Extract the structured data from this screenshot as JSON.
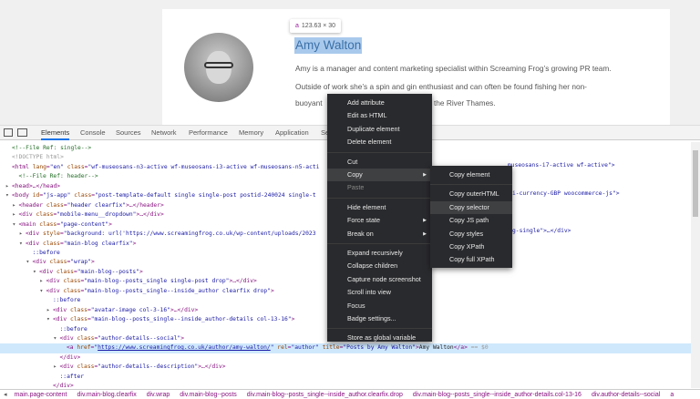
{
  "page": {
    "tooltip_tag": "a",
    "tooltip_size": "123.63 × 30",
    "author_name": "Amy Walton",
    "bio_line1": "Amy is a manager and content marketing specialist within Screaming Frog’s growing PR team.",
    "bio_line2": "Outside of work she’s a spin and gin enthusiast and can often be found fishing her non-",
    "bio_line3a": "buoyant",
    "bio_line3b": "the River Thames."
  },
  "devtools": {
    "tabs": [
      "Elements",
      "Console",
      "Sources",
      "Network",
      "Performance",
      "Memory",
      "Application",
      "Se"
    ],
    "active_tab": "Elements",
    "lines": [
      {
        "t": "<!--File Ref: single-->"
      },
      {
        "t": "<!DOCTYPE html>"
      },
      {
        "t": "<html lang=\"en\" class=\"wf-museosans-n3-active wf-museosans-i3-active wf-museosans-n5-acti"
      },
      {
        "t": "<!--File Ref: header-->"
      },
      {
        "t": "<head>…</head>"
      },
      {
        "t": "<body id=\"js-app\" class=\"post-template-default single single-post postid-240024 single-t"
      },
      {
        "t": "<header class=\"header clearfix\">…</header>"
      },
      {
        "t": "<div class=\"mobile-menu__dropdown\">…</div>"
      },
      {
        "t": "<main class=\"page-content\">"
      },
      {
        "t": "<div style=\"background: url('https://www.screamingfrog.co.uk/wp-content/uploads/2023"
      },
      {
        "t": "<div class=\"main-blog clearfix\">"
      },
      {
        "t": "::before"
      },
      {
        "t": "<div class=\"wrap\">"
      },
      {
        "t": "<div class=\"main-blog--posts\">"
      },
      {
        "t": "<div class=\"main-blog--posts_single single-post drop\">…</div>"
      },
      {
        "t": "<div class=\"main-blog--posts_single--inside_author clearfix drop\">"
      },
      {
        "t": "::before"
      },
      {
        "t": "<div class=\"avatar-image col-3-16\">…</div>"
      },
      {
        "t": "<div class=\"main-blog--posts_single--inside_author-details col-13-16\">"
      },
      {
        "t": "::before"
      },
      {
        "t": "<div class=\"author-details--social\">"
      },
      {
        "t": "<a href=\"https://www.screamingfrog.co.uk/author/amy-walton/\" rel=\"author\" title=\"Posts by Amy Walton\">Amy Walton</a> == $0"
      },
      {
        "t": "</div>"
      },
      {
        "t": "<div class=\"author-details--description\">…</div>"
      },
      {
        "t": "::after"
      },
      {
        "t": "</div>"
      }
    ],
    "right_fragments": [
      "museosans-i7-active wf-active\">",
      "i-currency-GBP woocommerce-js\">",
      "g-single\">…</div>"
    ],
    "breadcrumbs": [
      "main.page-content",
      "div.main-blog.clearfix",
      "div.wrap",
      "div.main-blog--posts",
      "div.main-blog--posts_single--inside_author.clearfix.drop",
      "div.main-blog--posts_single--inside_author-details.col-13-16",
      "div.author-details--social",
      "a"
    ]
  },
  "context_menu": {
    "items": [
      "Add attribute",
      "Edit as HTML",
      "Duplicate element",
      "Delete element",
      "Cut",
      "Copy",
      "Paste",
      "Hide element",
      "Force state",
      "Break on",
      "Expand recursively",
      "Collapse children",
      "Capture node screenshot",
      "Scroll into view",
      "Focus",
      "Badge settings...",
      "Store as global variable"
    ],
    "highlighted": "Copy",
    "disabled": "Paste",
    "submenu": [
      "Copy element",
      "Copy outerHTML",
      "Copy selector",
      "Copy JS path",
      "Copy styles",
      "Copy XPath",
      "Copy full XPath"
    ],
    "submenu_highlighted": "Copy selector"
  }
}
